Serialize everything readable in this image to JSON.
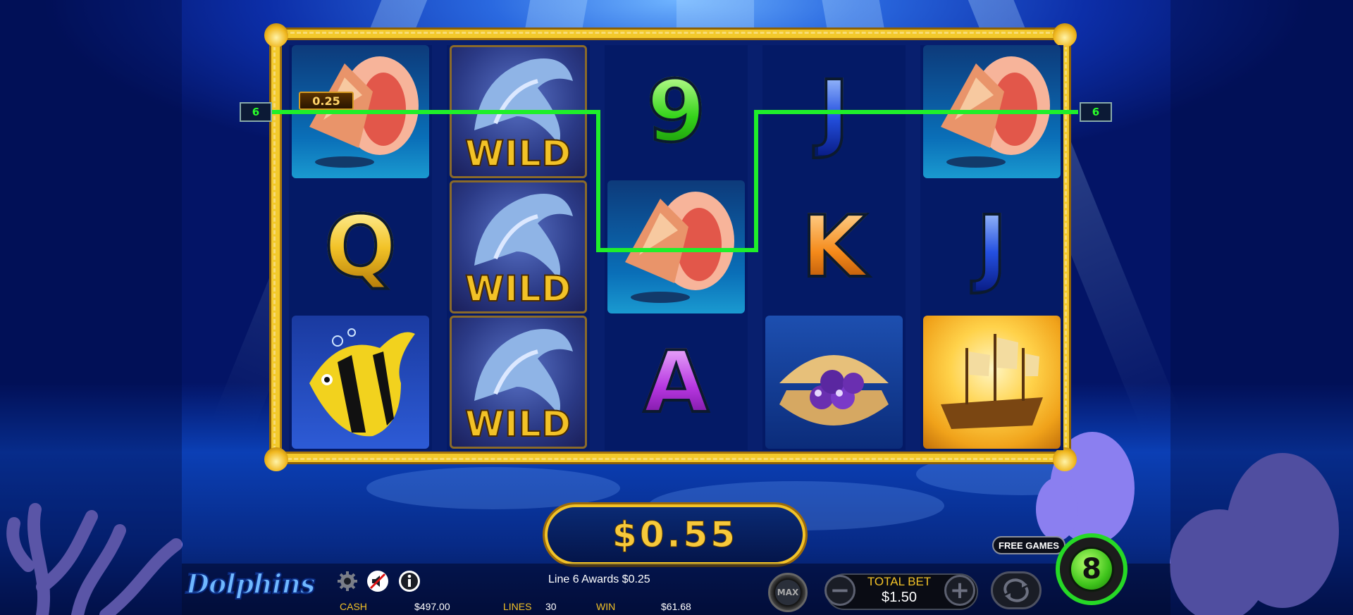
{
  "game": {
    "title": "Dolphins"
  },
  "colors": {
    "payline": "#1fef2a",
    "gold": "#f2c227",
    "background": "#0c2ea8"
  },
  "reels": [
    [
      {
        "symbol": "conch-shell"
      },
      {
        "symbol": "Q"
      },
      {
        "symbol": "angelfish"
      }
    ],
    [
      {
        "symbol": "wild-dolphin",
        "label": "WILD"
      },
      {
        "symbol": "wild-dolphin",
        "label": "WILD"
      },
      {
        "symbol": "wild-dolphin",
        "label": "WILD"
      }
    ],
    [
      {
        "symbol": "9"
      },
      {
        "symbol": "conch-shell"
      },
      {
        "symbol": "A"
      }
    ],
    [
      {
        "symbol": "J"
      },
      {
        "symbol": "K"
      },
      {
        "symbol": "pearl-clam"
      }
    ],
    [
      {
        "symbol": "conch-shell"
      },
      {
        "symbol": "J"
      },
      {
        "symbol": "ship"
      }
    ]
  ],
  "payline": {
    "left_number": "6",
    "right_number": "6",
    "award_label": "0.25"
  },
  "win": {
    "amount": "$0.55"
  },
  "status": {
    "message": "Line 6 Awards $0.25"
  },
  "stats": {
    "cash_label": "CASH",
    "cash_value": "$497.00",
    "lines_label": "LINES",
    "lines_value": "30",
    "win_label": "WIN",
    "win_value": "$61.68"
  },
  "controls": {
    "max_label": "MAX",
    "total_bet_label": "TOTAL BET",
    "total_bet_value": "$1.50",
    "decrease_symbol": "−",
    "increase_symbol": "+"
  },
  "free_games": {
    "label": "FREE GAMES",
    "count": "8"
  },
  "icons": [
    "gear-icon",
    "sound-muted-icon",
    "info-icon",
    "autoplay-icon"
  ]
}
